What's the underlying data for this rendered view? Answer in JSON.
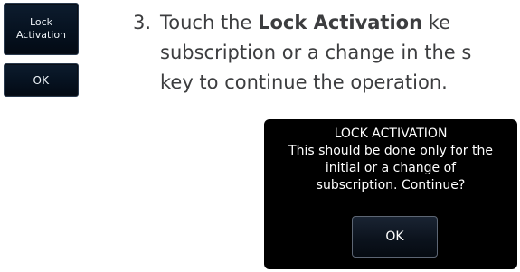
{
  "side_keys": {
    "lock_activation": {
      "line1": "Lock",
      "line2": "Activation"
    },
    "ok": "OK"
  },
  "instruction": {
    "number": "3.",
    "line1_pre": "Touch the ",
    "line1_bold": "Lock Activation",
    "line1_post": " ke",
    "line2": "subscription or a change in the s",
    "line3": "key to continue the operation."
  },
  "dialog": {
    "title": "LOCK ACTIVATION",
    "message_lines": [
      "This should be done only for the",
      "initial or a change of",
      "subscription. Continue?"
    ],
    "ok_label": "OK"
  },
  "colors": {
    "key_background": "#061220",
    "dialog_background": "#000000",
    "body_text": "#3c3d3f"
  }
}
